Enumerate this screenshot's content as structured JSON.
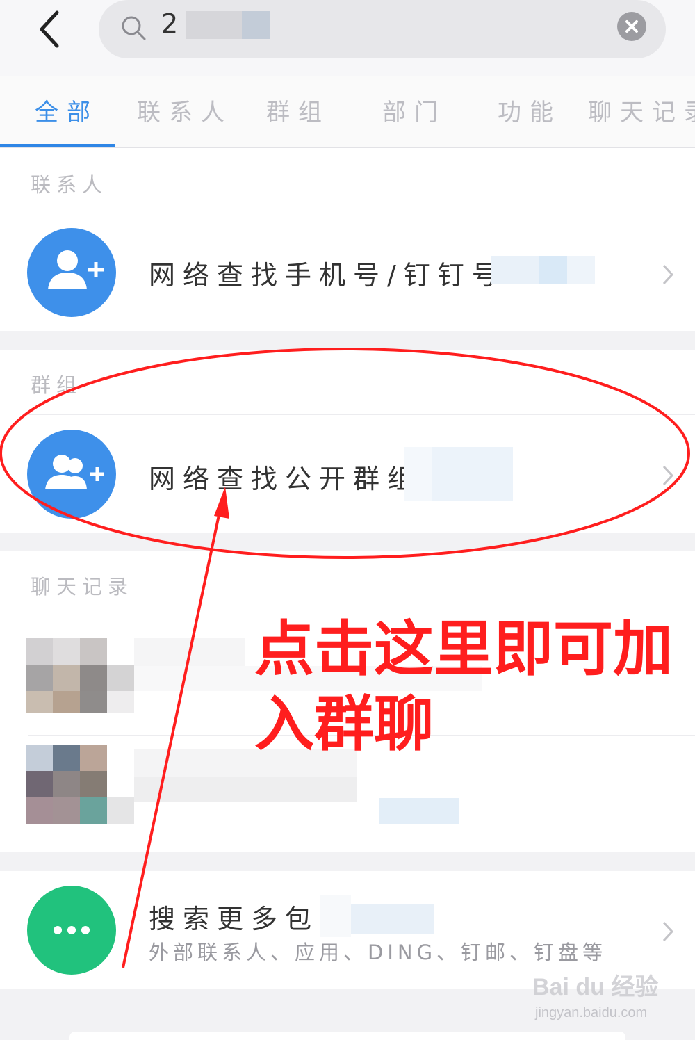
{
  "search": {
    "query": "2",
    "placeholder": ""
  },
  "tabs": [
    {
      "label": "全部",
      "active": true
    },
    {
      "label": "联系人",
      "active": false
    },
    {
      "label": "群组",
      "active": false
    },
    {
      "label": "部门",
      "active": false
    },
    {
      "label": "功能",
      "active": false
    },
    {
      "label": "聊天记录",
      "active": false
    }
  ],
  "sections": {
    "contacts": {
      "title": "联系人",
      "row_label": "网络查找手机号/钉钉号:",
      "row_value": "2"
    },
    "groups": {
      "title": "群组",
      "row_label": "网络查找公开群组:"
    },
    "chat_history": {
      "title": "聊天记录"
    },
    "more": {
      "title": "搜索更多包含",
      "subtitle": "外部联系人、应用、DING、钉邮、钉盘等"
    }
  },
  "annotation": {
    "text_line1": "点击这里即可加",
    "text_line2": "入群聊",
    "color": "#ff1e1e"
  },
  "watermark": {
    "logo": "Bai du 经验",
    "url": "jingyan.baidu.com"
  },
  "colors": {
    "accent": "#2f86e6",
    "avatar_blue": "#3e90ea",
    "avatar_green": "#21c27d"
  },
  "icons": [
    "back-arrow-icon",
    "search-icon",
    "clear-icon",
    "add-contact-icon",
    "add-group-icon",
    "more-icon",
    "chevron-right-icon"
  ]
}
